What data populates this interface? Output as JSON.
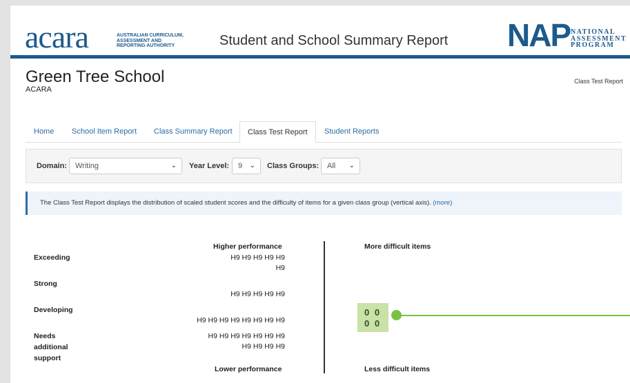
{
  "header": {
    "acara_logo": "acara",
    "acara_sub_1": "AUSTRALIAN CURRICULUM,",
    "acara_sub_2": "ASSESSMENT AND",
    "acara_sub_3": "REPORTING AUTHORITY",
    "title": "Student and School Summary Report",
    "nap_logo": "NAP",
    "nap_sub_1": "NATIONAL",
    "nap_sub_2": "ASSESSMENT",
    "nap_sub_3": "PROGRAM"
  },
  "school": {
    "name": "Green Tree School",
    "sub": "ACARA",
    "breadcrumb": "Class Test Report"
  },
  "tabs": [
    {
      "label": "Home"
    },
    {
      "label": "School Item Report"
    },
    {
      "label": "Class Summary Report"
    },
    {
      "label": "Class Test Report"
    },
    {
      "label": "Student Reports"
    }
  ],
  "filters": {
    "domain_label": "Domain:",
    "domain_value": "Writing",
    "year_label": "Year Level:",
    "year_value": "9",
    "groups_label": "Class Groups:",
    "groups_value": "All"
  },
  "info": {
    "text": "The Class Test Report displays the distribution of scaled student scores and the difficulty of items for a given class group (vertical axis).",
    "more": "(more)"
  },
  "chart": {
    "higher": "Higher performance",
    "lower": "Lower performance",
    "more_difficult": "More difficult items",
    "less_difficult": "Less difficult items",
    "levels": {
      "exceeding": "Exceeding",
      "strong": "Strong",
      "developing": "Developing",
      "needs_1": "Needs",
      "needs_2": "additional",
      "needs_3": "support"
    },
    "score_rows": [
      "H9 H9 H9 H9 H9",
      "H9",
      "H9 H9 H9 H9 H9",
      "H9 H9 H9 H9 H9 H9 H9 H9",
      "H9 H9 H9 H9 H9 H9 H9",
      "H9 H9 H9 H9"
    ],
    "item_cluster": [
      "0 0",
      "0 0"
    ]
  },
  "colors": {
    "brand": "#1d5a8c",
    "link": "#2b6ca3",
    "cluster": "#c9e2a8",
    "marker": "#7ac142"
  }
}
